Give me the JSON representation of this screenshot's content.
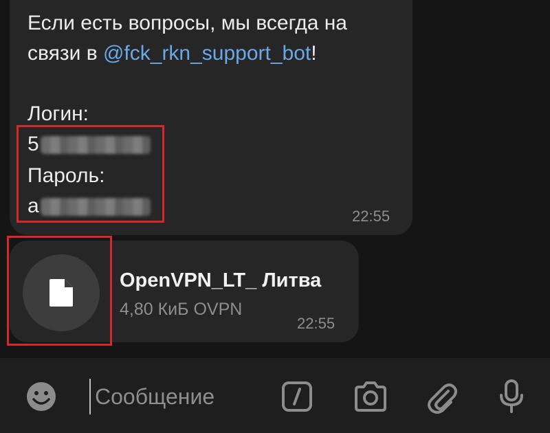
{
  "message": {
    "line1": "Если есть вопросы, мы всегда на",
    "line2_prefix": "связи в ",
    "mention": "@fck_rkn_support_bot",
    "line2_suffix": "!",
    "login_label": "Логин:",
    "login_value_visible": "5",
    "password_label": "Пароль:",
    "password_value_visible": "a",
    "time": "22:55"
  },
  "file": {
    "name": "OpenVPN_LT_ Литва",
    "meta": "4,80 КиБ OVPN",
    "time": "22:55",
    "icon": "document-icon"
  },
  "composer": {
    "placeholder": "Сообщение",
    "icons": [
      "emoji-icon",
      "bot-command-icon",
      "camera-icon",
      "attach-icon",
      "microphone-icon"
    ]
  },
  "colors": {
    "background": "#151515",
    "bubble": "#262626",
    "link": "#6aa9e9",
    "highlight": "#d6272a"
  }
}
